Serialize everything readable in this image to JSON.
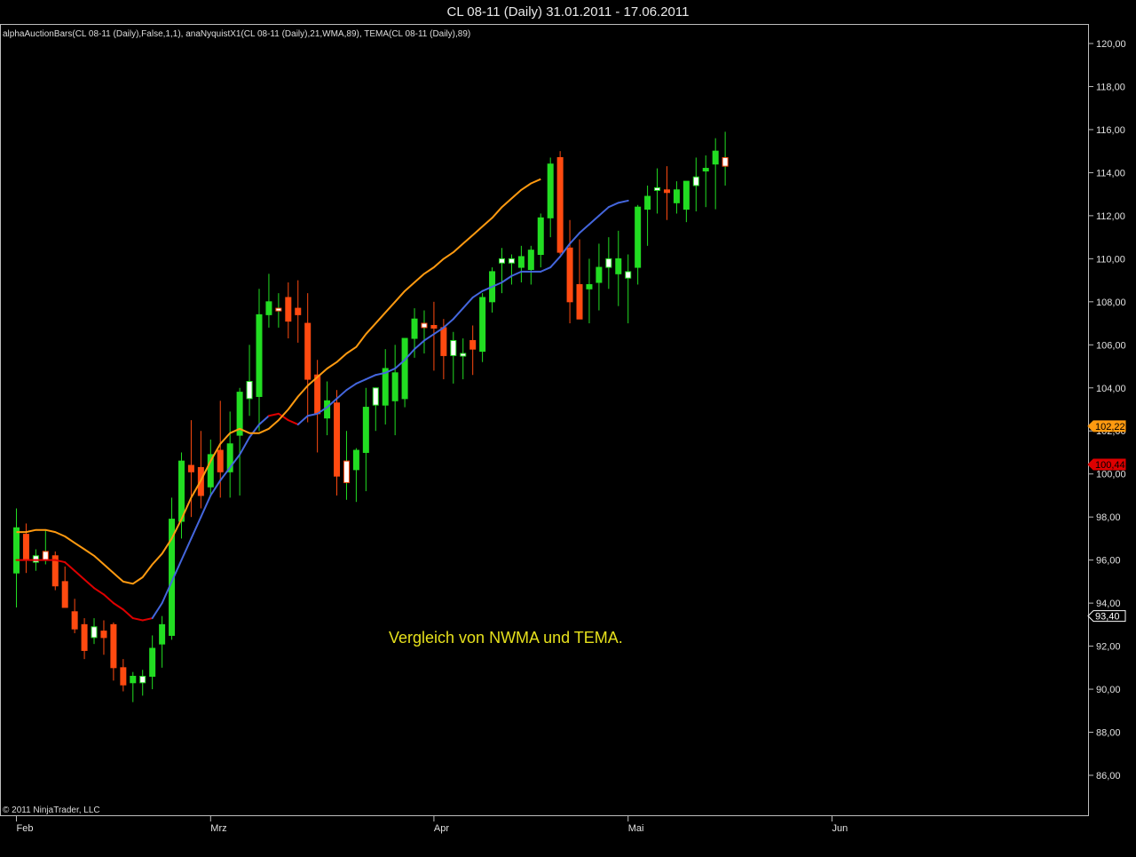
{
  "window": {
    "title": "CL 08-11 (Daily)  31.01.2011 - 17.06.2011",
    "indicators": "alphaAuctionBars(CL 08-11 (Daily),False,1,1), anaNyquistX1(CL 08-11 (Daily),21,WMA,89), TEMA(CL 08-11 (Daily),89)",
    "copyright": "© 2011 NinjaTrader, LLC",
    "annotation": "Vergleich von NWMA und TEMA."
  },
  "chart_data": {
    "type": "candlestick",
    "y_axis": {
      "range": [
        84.4,
        121.0
      ],
      "ticks": [
        "120,00",
        "118,00",
        "116,00",
        "114,00",
        "112,00",
        "110,00",
        "108,00",
        "106,00",
        "104,00",
        "102,00",
        "100,00",
        "98,00",
        "96,00",
        "94,00",
        "92,00",
        "90,00",
        "88,00",
        "86,00"
      ],
      "tick_values": [
        120,
        118,
        116,
        114,
        112,
        110,
        108,
        106,
        104,
        102,
        100,
        98,
        96,
        94,
        92,
        90,
        88,
        86
      ]
    },
    "x_axis": {
      "labels": [
        {
          "label": "Feb",
          "index": 0
        },
        {
          "label": "Mrz",
          "index": 20
        },
        {
          "label": "Apr",
          "index": 43
        },
        {
          "label": "Mai",
          "index": 63
        },
        {
          "label": "Jun",
          "index": 84
        }
      ]
    },
    "colors": {
      "up": "#22dd22",
      "down": "#ff4a10",
      "small_body": "#ffffff",
      "nwma_red": "#dd0000",
      "nwma_blue": "#4466dd",
      "tema": "#ff9a10"
    },
    "candles": [
      {
        "o": 95.4,
        "h": 98.4,
        "l": 93.8,
        "c": 97.5,
        "k": "up"
      },
      {
        "o": 97.2,
        "h": 97.7,
        "l": 95.4,
        "c": 96.0,
        "k": "down"
      },
      {
        "o": 95.9,
        "h": 96.5,
        "l": 95.5,
        "c": 96.2,
        "k": "small"
      },
      {
        "o": 96.4,
        "h": 97.4,
        "l": 95.8,
        "c": 96.0,
        "k": "small"
      },
      {
        "o": 96.2,
        "h": 96.4,
        "l": 94.6,
        "c": 94.8,
        "k": "down"
      },
      {
        "o": 95.0,
        "h": 95.7,
        "l": 93.8,
        "c": 93.8,
        "k": "down"
      },
      {
        "o": 93.6,
        "h": 94.2,
        "l": 92.6,
        "c": 92.8,
        "k": "down"
      },
      {
        "o": 93.0,
        "h": 93.3,
        "l": 91.4,
        "c": 91.8,
        "k": "down"
      },
      {
        "o": 92.4,
        "h": 93.3,
        "l": 92.1,
        "c": 92.9,
        "k": "small"
      },
      {
        "o": 92.7,
        "h": 93.2,
        "l": 91.6,
        "c": 92.4,
        "k": "down"
      },
      {
        "o": 93.0,
        "h": 93.1,
        "l": 90.4,
        "c": 91.0,
        "k": "down"
      },
      {
        "o": 91.0,
        "h": 91.4,
        "l": 89.9,
        "c": 90.2,
        "k": "down"
      },
      {
        "o": 90.3,
        "h": 90.8,
        "l": 89.4,
        "c": 90.6,
        "k": "up"
      },
      {
        "o": 90.3,
        "h": 90.9,
        "l": 89.7,
        "c": 90.6,
        "k": "small"
      },
      {
        "o": 90.6,
        "h": 92.5,
        "l": 90.0,
        "c": 91.9,
        "k": "up"
      },
      {
        "o": 92.1,
        "h": 93.4,
        "l": 91.0,
        "c": 93.0,
        "k": "up"
      },
      {
        "o": 92.5,
        "h": 98.9,
        "l": 92.3,
        "c": 97.9,
        "k": "up"
      },
      {
        "o": 97.8,
        "h": 101.0,
        "l": 97.0,
        "c": 100.6,
        "k": "up"
      },
      {
        "o": 100.4,
        "h": 102.5,
        "l": 98.0,
        "c": 100.1,
        "k": "down"
      },
      {
        "o": 100.3,
        "h": 102.0,
        "l": 98.4,
        "c": 99.0,
        "k": "down"
      },
      {
        "o": 99.4,
        "h": 101.6,
        "l": 99.0,
        "c": 100.9,
        "k": "up"
      },
      {
        "o": 101.1,
        "h": 103.4,
        "l": 98.9,
        "c": 100.1,
        "k": "down"
      },
      {
        "o": 100.1,
        "h": 102.9,
        "l": 98.9,
        "c": 101.4,
        "k": "up"
      },
      {
        "o": 101.8,
        "h": 104.0,
        "l": 99.0,
        "c": 103.8,
        "k": "up"
      },
      {
        "o": 103.5,
        "h": 106.0,
        "l": 102.7,
        "c": 104.3,
        "k": "small"
      },
      {
        "o": 103.6,
        "h": 108.6,
        "l": 102.0,
        "c": 107.4,
        "k": "up"
      },
      {
        "o": 107.4,
        "h": 109.3,
        "l": 106.8,
        "c": 108.0,
        "k": "up"
      },
      {
        "o": 107.7,
        "h": 108.4,
        "l": 106.8,
        "c": 107.6,
        "k": "small"
      },
      {
        "o": 108.2,
        "h": 108.9,
        "l": 106.3,
        "c": 107.1,
        "k": "down"
      },
      {
        "o": 107.7,
        "h": 109.0,
        "l": 106.1,
        "c": 107.4,
        "k": "down"
      },
      {
        "o": 107.0,
        "h": 108.4,
        "l": 102.4,
        "c": 104.4,
        "k": "down"
      },
      {
        "o": 104.6,
        "h": 105.3,
        "l": 101.0,
        "c": 102.8,
        "k": "down"
      },
      {
        "o": 103.4,
        "h": 104.3,
        "l": 101.8,
        "c": 102.6,
        "k": "up"
      },
      {
        "o": 103.3,
        "h": 103.9,
        "l": 99.0,
        "c": 99.9,
        "k": "down"
      },
      {
        "o": 100.6,
        "h": 102.0,
        "l": 98.8,
        "c": 99.6,
        "k": "small"
      },
      {
        "o": 100.2,
        "h": 101.2,
        "l": 98.7,
        "c": 101.1,
        "k": "up"
      },
      {
        "o": 101.0,
        "h": 104.0,
        "l": 99.2,
        "c": 103.1,
        "k": "up"
      },
      {
        "o": 103.2,
        "h": 103.5,
        "l": 102.0,
        "c": 104.0,
        "k": "small"
      },
      {
        "o": 103.2,
        "h": 105.8,
        "l": 102.3,
        "c": 104.9,
        "k": "up"
      },
      {
        "o": 104.7,
        "h": 106.0,
        "l": 101.8,
        "c": 103.4,
        "k": "up"
      },
      {
        "o": 103.5,
        "h": 106.3,
        "l": 103.1,
        "c": 106.3,
        "k": "up"
      },
      {
        "o": 106.3,
        "h": 107.7,
        "l": 105.4,
        "c": 107.2,
        "k": "up"
      },
      {
        "o": 107.0,
        "h": 107.6,
        "l": 105.6,
        "c": 106.8,
        "k": "small"
      },
      {
        "o": 106.8,
        "h": 108.0,
        "l": 104.8,
        "c": 106.9,
        "k": "down"
      },
      {
        "o": 106.8,
        "h": 107.2,
        "l": 104.4,
        "c": 105.5,
        "k": "down"
      },
      {
        "o": 105.5,
        "h": 106.6,
        "l": 104.2,
        "c": 106.2,
        "k": "small"
      },
      {
        "o": 105.5,
        "h": 106.3,
        "l": 104.4,
        "c": 105.6,
        "k": "small"
      },
      {
        "o": 105.8,
        "h": 106.9,
        "l": 104.6,
        "c": 106.2,
        "k": "down"
      },
      {
        "o": 105.7,
        "h": 108.4,
        "l": 105.2,
        "c": 108.2,
        "k": "up"
      },
      {
        "o": 108.0,
        "h": 109.6,
        "l": 107.5,
        "c": 109.4,
        "k": "up"
      },
      {
        "o": 109.8,
        "h": 110.5,
        "l": 108.4,
        "c": 110.0,
        "k": "small"
      },
      {
        "o": 109.8,
        "h": 110.2,
        "l": 108.8,
        "c": 110.0,
        "k": "small"
      },
      {
        "o": 109.6,
        "h": 110.6,
        "l": 108.9,
        "c": 110.1,
        "k": "up"
      },
      {
        "o": 109.5,
        "h": 110.6,
        "l": 108.8,
        "c": 110.4,
        "k": "up"
      },
      {
        "o": 110.2,
        "h": 112.1,
        "l": 109.6,
        "c": 111.9,
        "k": "up"
      },
      {
        "o": 111.9,
        "h": 114.7,
        "l": 111.0,
        "c": 114.4,
        "k": "up"
      },
      {
        "o": 114.7,
        "h": 115.0,
        "l": 110.2,
        "c": 110.3,
        "k": "down"
      },
      {
        "o": 110.5,
        "h": 111.8,
        "l": 107.0,
        "c": 108.0,
        "k": "down"
      },
      {
        "o": 108.8,
        "h": 110.9,
        "l": 107.2,
        "c": 107.2,
        "k": "down"
      },
      {
        "o": 108.8,
        "h": 110.0,
        "l": 107.0,
        "c": 108.6,
        "k": "up"
      },
      {
        "o": 108.9,
        "h": 110.7,
        "l": 107.6,
        "c": 109.6,
        "k": "up"
      },
      {
        "o": 109.6,
        "h": 111.0,
        "l": 108.6,
        "c": 110.0,
        "k": "small"
      },
      {
        "o": 110.0,
        "h": 111.3,
        "l": 107.8,
        "c": 109.3,
        "k": "up"
      },
      {
        "o": 109.1,
        "h": 110.2,
        "l": 107.0,
        "c": 109.4,
        "k": "small"
      },
      {
        "o": 109.6,
        "h": 112.5,
        "l": 108.8,
        "c": 112.4,
        "k": "up"
      },
      {
        "o": 112.3,
        "h": 113.4,
        "l": 110.6,
        "c": 112.9,
        "k": "up"
      },
      {
        "o": 113.2,
        "h": 114.2,
        "l": 112.1,
        "c": 113.3,
        "k": "small"
      },
      {
        "o": 113.2,
        "h": 114.3,
        "l": 111.8,
        "c": 113.1,
        "k": "down"
      },
      {
        "o": 112.6,
        "h": 113.6,
        "l": 112.1,
        "c": 113.2,
        "k": "up"
      },
      {
        "o": 112.3,
        "h": 113.4,
        "l": 111.7,
        "c": 113.6,
        "k": "up"
      },
      {
        "o": 113.4,
        "h": 114.7,
        "l": 112.2,
        "c": 113.8,
        "k": "small"
      },
      {
        "o": 114.2,
        "h": 114.8,
        "l": 112.4,
        "c": 114.1,
        "k": "up"
      },
      {
        "o": 114.4,
        "h": 115.6,
        "l": 112.3,
        "c": 115.0,
        "k": "up"
      },
      {
        "o": 114.7,
        "h": 115.9,
        "l": 113.4,
        "c": 114.3,
        "k": "small"
      }
    ],
    "nwma": [
      96.0,
      96.0,
      96.0,
      96.0,
      96.0,
      95.9,
      95.5,
      95.1,
      94.7,
      94.4,
      94.0,
      93.7,
      93.3,
      93.2,
      93.3,
      94.0,
      95.0,
      96.0,
      97.0,
      98.0,
      99.0,
      99.7,
      100.3,
      100.9,
      101.7,
      102.3,
      102.7,
      102.8,
      102.5,
      102.3,
      102.7,
      102.8,
      103.1,
      103.5,
      103.9,
      104.2,
      104.4,
      104.6,
      104.7,
      104.9,
      105.3,
      105.8,
      106.2,
      106.5,
      106.8,
      107.2,
      107.7,
      108.2,
      108.5,
      108.7,
      108.9,
      109.2,
      109.4,
      109.4,
      109.4,
      109.6,
      110.1,
      110.7,
      111.2,
      111.6,
      112.0,
      112.4,
      112.6,
      112.7
    ],
    "tema": [
      97.3,
      97.3,
      97.4,
      97.4,
      97.3,
      97.1,
      96.8,
      96.5,
      96.2,
      95.8,
      95.4,
      95.0,
      94.9,
      95.2,
      95.8,
      96.3,
      97.0,
      97.9,
      98.9,
      99.7,
      100.6,
      101.4,
      101.9,
      102.1,
      101.9,
      101.9,
      102.1,
      102.5,
      103.0,
      103.6,
      104.1,
      104.5,
      104.9,
      105.2,
      105.6,
      105.9,
      106.5,
      107.0,
      107.5,
      108.0,
      108.5,
      108.9,
      109.3,
      109.6,
      110.0,
      110.3,
      110.7,
      111.1,
      111.5,
      111.9,
      112.4,
      112.8,
      113.2,
      113.5,
      113.7
    ],
    "last_values": [
      {
        "label": "102,22",
        "value": 102.22,
        "color": "#ff9a10"
      },
      {
        "label": "100,44",
        "value": 100.44,
        "color": "#dd0000"
      },
      {
        "label": "93,40",
        "value": 93.4,
        "color": "#ffffff"
      }
    ]
  }
}
